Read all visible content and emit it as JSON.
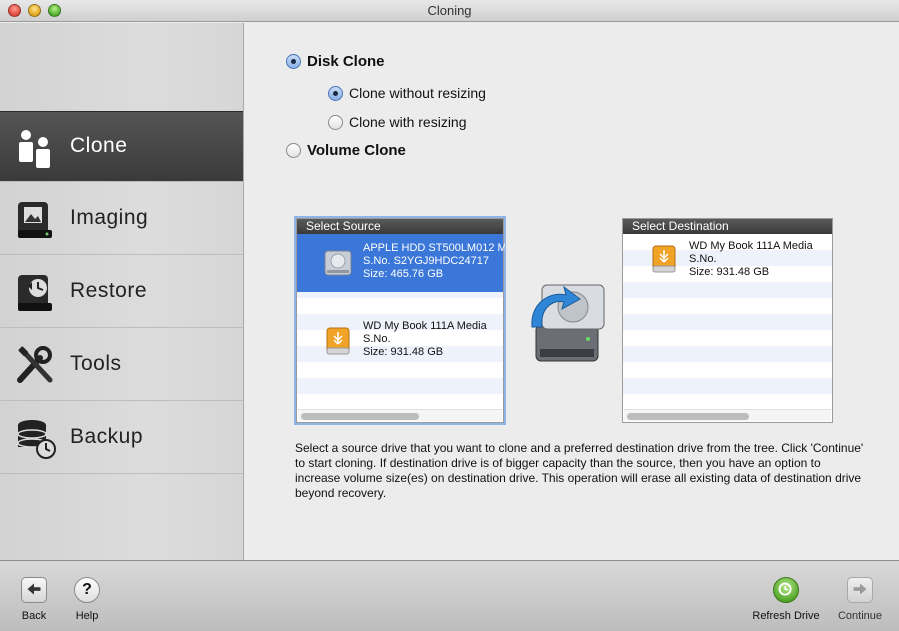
{
  "window": {
    "title": "Cloning"
  },
  "sidebar": {
    "items": [
      {
        "label": "Clone",
        "icon": "clone-icon",
        "active": true
      },
      {
        "label": "Imaging",
        "icon": "imaging-icon",
        "active": false
      },
      {
        "label": "Restore",
        "icon": "restore-icon",
        "active": false
      },
      {
        "label": "Tools",
        "icon": "tools-icon",
        "active": false
      },
      {
        "label": "Backup",
        "icon": "backup-icon",
        "active": false
      }
    ]
  },
  "options": {
    "disk_clone": "Disk Clone",
    "clone_without_resizing": "Clone without resizing",
    "clone_with_resizing": "Clone with resizing",
    "volume_clone": "Volume Clone",
    "selected_mode": "disk_clone",
    "selected_sub": "clone_without_resizing"
  },
  "source": {
    "header": "Select Source",
    "drives": [
      {
        "name": "APPLE HDD ST500LM012 M",
        "serial": "S.No. S2YGJ9HDC24717",
        "size": "Size: 465.76 GB",
        "icon": "hard-drive-icon",
        "selected": true
      },
      {
        "name": "WD My Book 111A Media",
        "serial": "S.No.",
        "size": "Size: 931.48 GB",
        "icon": "usb-drive-icon",
        "selected": false
      }
    ]
  },
  "destination": {
    "header": "Select Destination",
    "drives": [
      {
        "name": "WD My Book 111A Media",
        "serial": "S.No.",
        "size": "Size: 931.48 GB",
        "icon": "usb-drive-icon",
        "selected": false
      }
    ]
  },
  "description": "Select a source drive that you want to clone and a preferred destination drive from the tree. Click 'Continue' to start cloning. If destination drive is of bigger capacity than the source, then you have an option to increase volume size(es) on destination drive. This operation will erase all existing data of destination drive beyond recovery.",
  "toolbar": {
    "back": "Back",
    "help": "Help",
    "refresh": "Refresh Drive",
    "continue": "Continue"
  },
  "colors": {
    "accent": "#3b77d9",
    "active_nav": "#444444",
    "refresh_green": "#5cb82e"
  }
}
